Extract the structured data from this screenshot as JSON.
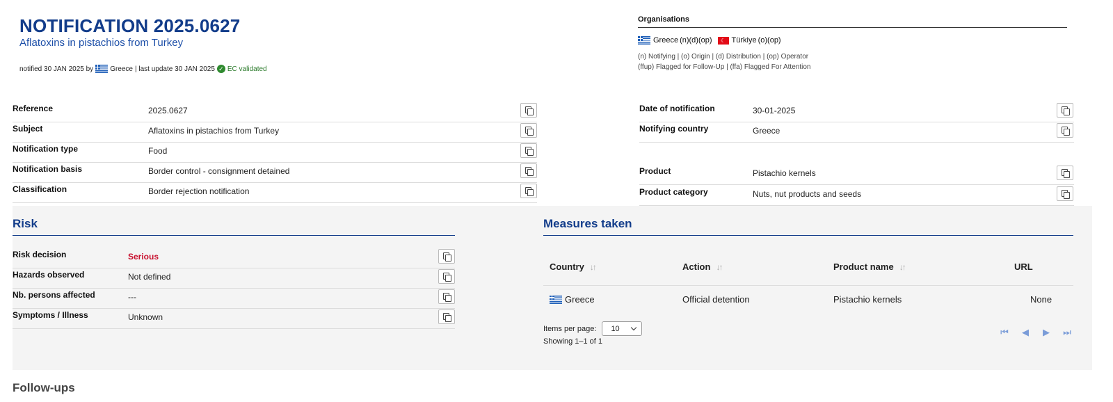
{
  "header": {
    "title": "NOTIFICATION 2025.0627",
    "subtitle": "Aflatoxins in pistachios from Turkey",
    "notified_prefix": "notified 30 JAN 2025 by",
    "notified_country": "Greece",
    "last_update": "| last update 30 JAN 2025",
    "validated": "EC validated"
  },
  "organisations": {
    "title": "Organisations",
    "entries": [
      {
        "country": "Greece",
        "roles": "(n)(d)(op)"
      },
      {
        "country": "Türkiye",
        "roles": "(o)(op)"
      }
    ],
    "legend_line1": "(n) Notifying | (o) Origin | (d) Distribution | (op) Operator",
    "legend_line2": "(ffup) Flagged for Follow-Up | (ffa) Flagged For Attention"
  },
  "left_fields": [
    {
      "label": "Reference",
      "value": "2025.0627"
    },
    {
      "label": "Subject",
      "value": "Aflatoxins in pistachios from Turkey"
    },
    {
      "label": "Notification type",
      "value": "Food"
    },
    {
      "label": "Notification basis",
      "value": "Border control - consignment detained"
    },
    {
      "label": "Classification",
      "value": "Border rejection notification"
    }
  ],
  "right_fields": [
    {
      "label": "Date of notification",
      "value": "30-01-2025"
    },
    {
      "label": "Notifying country",
      "value": "Greece"
    },
    {
      "label": "Product",
      "value": "Pistachio kernels"
    },
    {
      "label": "Product category",
      "value": "Nuts, nut products and seeds"
    }
  ],
  "risk": {
    "title": "Risk",
    "fields": [
      {
        "label": "Risk decision",
        "value": "Serious"
      },
      {
        "label": "Hazards observed",
        "value": "Not defined"
      },
      {
        "label": "Nb. persons affected",
        "value": "---"
      },
      {
        "label": "Symptoms / Illness",
        "value": "Unknown"
      }
    ]
  },
  "measures": {
    "title": "Measures taken",
    "columns": [
      "Country",
      "Action",
      "Product name",
      "URL"
    ],
    "rows": [
      {
        "country": "Greece",
        "action": "Official detention",
        "product": "Pistachio kernels",
        "url": "None"
      }
    ],
    "items_per_page_label": "Items per page:",
    "items_per_page_value": "10",
    "showing": "Showing 1–1 of 1"
  },
  "followups": {
    "title": "Follow-ups"
  },
  "icons": {
    "copy": "copy-icon",
    "check": "check-circle-icon",
    "sort": "sort-icon",
    "pager": [
      "first-page-icon",
      "prev-page-icon",
      "next-page-icon",
      "last-page-icon"
    ]
  },
  "colors": {
    "brand_blue": "#123c8a",
    "serious_red": "#c8102e",
    "validated_green": "#2a7a2a",
    "panel_grey": "#f4f4f4"
  }
}
